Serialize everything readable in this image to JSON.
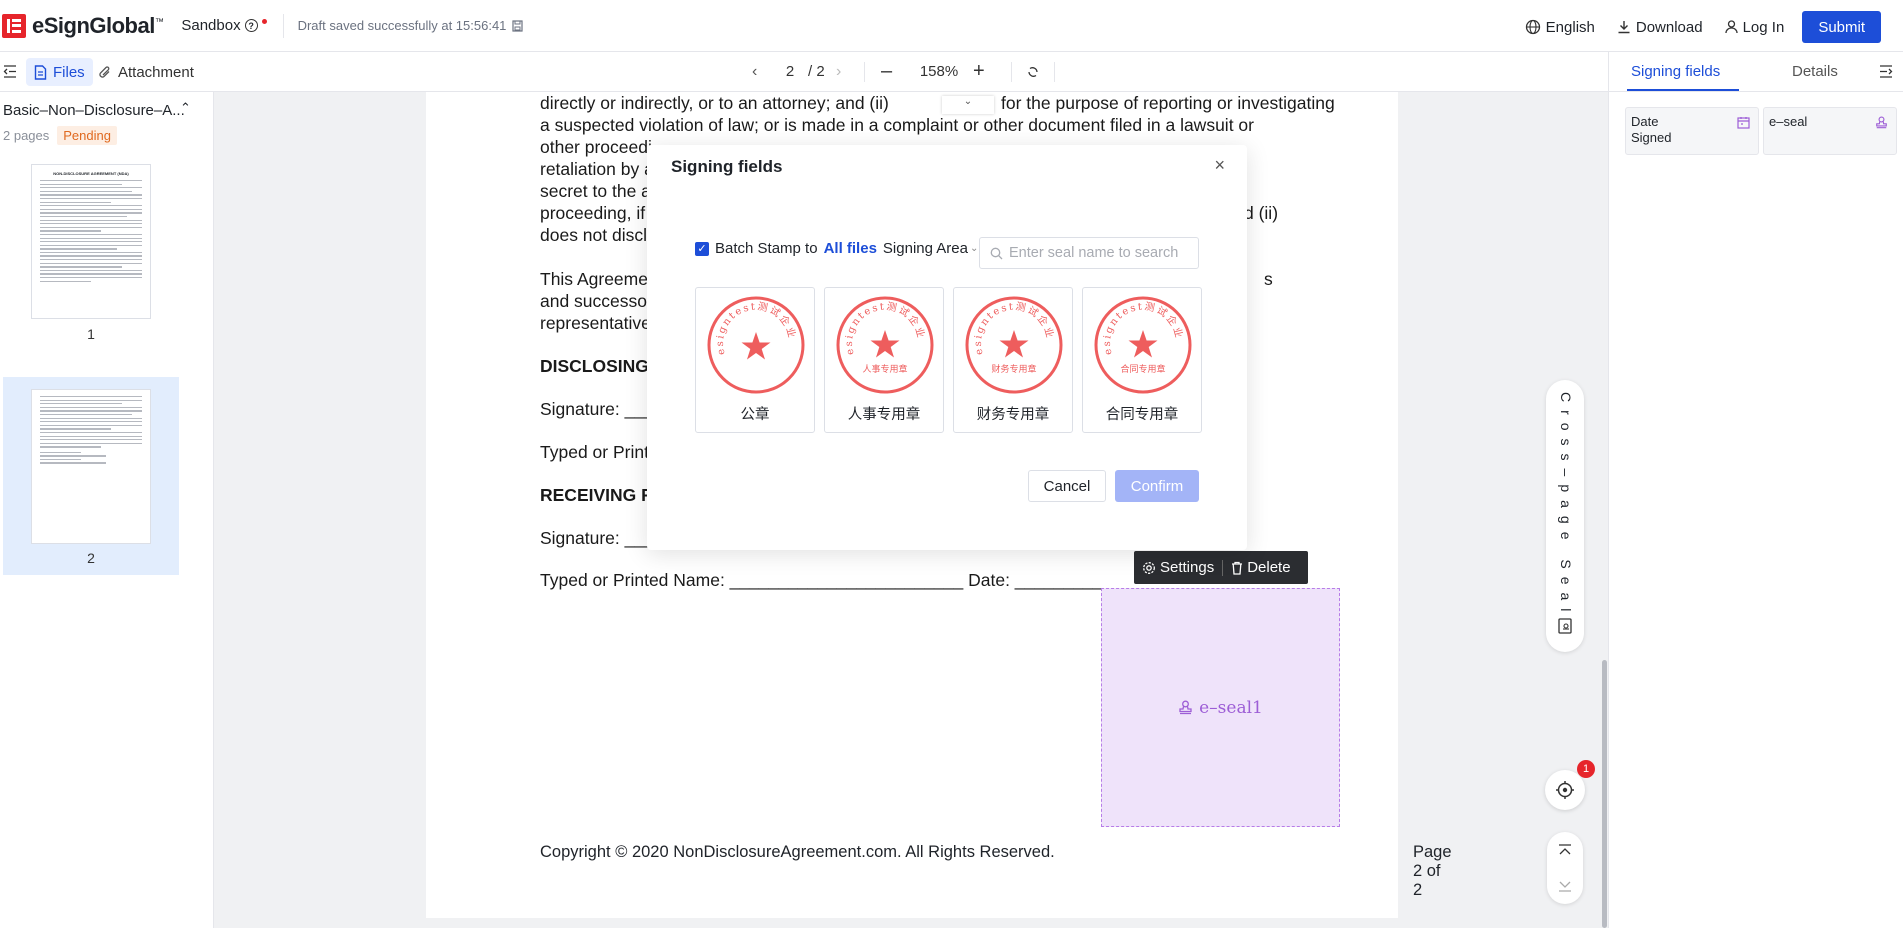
{
  "header": {
    "brand": "eSignGlobal",
    "brand_tm": "™",
    "sandbox_label": "Sandbox",
    "draft_status": "Draft saved successfully at 15:56:41",
    "language_label": "English",
    "download_label": "Download",
    "login_label": "Log In",
    "submit_label": "Submit",
    "accent_color": "#1d4ed8",
    "brand_color": "#e6252b"
  },
  "toolbar": {
    "files_tab": "Files",
    "attachment_tab": "Attachment",
    "current_page": "2",
    "total_pages": "/ 2",
    "zoom": "158%"
  },
  "left_panel": {
    "doc_name": "Basic–Non–Disclosure–A...",
    "page_count": "2 pages",
    "status_badge": "Pending",
    "thumbnails": [
      {
        "number": "1"
      },
      {
        "number": "2"
      }
    ]
  },
  "document": {
    "lines": [
      "directly or indirectly, or to an attorney; and (ii)",
      "for the purpose of reporting or investigating",
      "a suspected violation of law; or is made in a complaint or other document filed in a lawsuit or",
      "other proceedi",
      "retaliation by a",
      "secret to the a",
      "proceeding, if",
      "d (ii)",
      "does not discl",
      "This Agreeme",
      "s",
      "and successo",
      "representative",
      "DISCLOSING",
      "Signature: ___",
      "Typed or Print",
      "RECEIVING P",
      "Signature: ___",
      "Typed or Printed Name: ________________________ Date: _____________"
    ],
    "footer_left": "Copyright © 2020 NonDisclosureAgreement.com. All Rights Reserved.",
    "footer_right": "Page 2 of 2"
  },
  "seal_field": {
    "label": "e–seal1",
    "settings_label": "Settings",
    "delete_label": "Delete"
  },
  "modal": {
    "title": "Signing fields",
    "batch_prefix": "Batch Stamp to",
    "batch_scope": "All files",
    "batch_suffix": "Signing Area",
    "search_placeholder": "Enter seal name to search",
    "seals": [
      {
        "name": "公章",
        "ring_text": "esigntest测试企业",
        "inner_text": ""
      },
      {
        "name": "人事专用章",
        "ring_text": "esigntest测试企业",
        "inner_text": "人事专用章"
      },
      {
        "name": "财务专用章",
        "ring_text": "esigntest测试企业",
        "inner_text": "财务专用章"
      },
      {
        "name": "合同专用章",
        "ring_text": "esigntest测试企业",
        "inner_text": "合同专用章"
      }
    ],
    "seal_color": "#ee5d5d",
    "cancel_label": "Cancel",
    "confirm_label": "Confirm"
  },
  "floating": {
    "cross_page_seal": "Cross–page Seal",
    "locate_badge": "1"
  },
  "right_panel": {
    "tabs": [
      "Signing fields",
      "Details"
    ],
    "fields": [
      {
        "label": "Date Signed",
        "icon": "calendar-icon"
      },
      {
        "label": "e–seal",
        "icon": "stamp-icon"
      }
    ]
  }
}
